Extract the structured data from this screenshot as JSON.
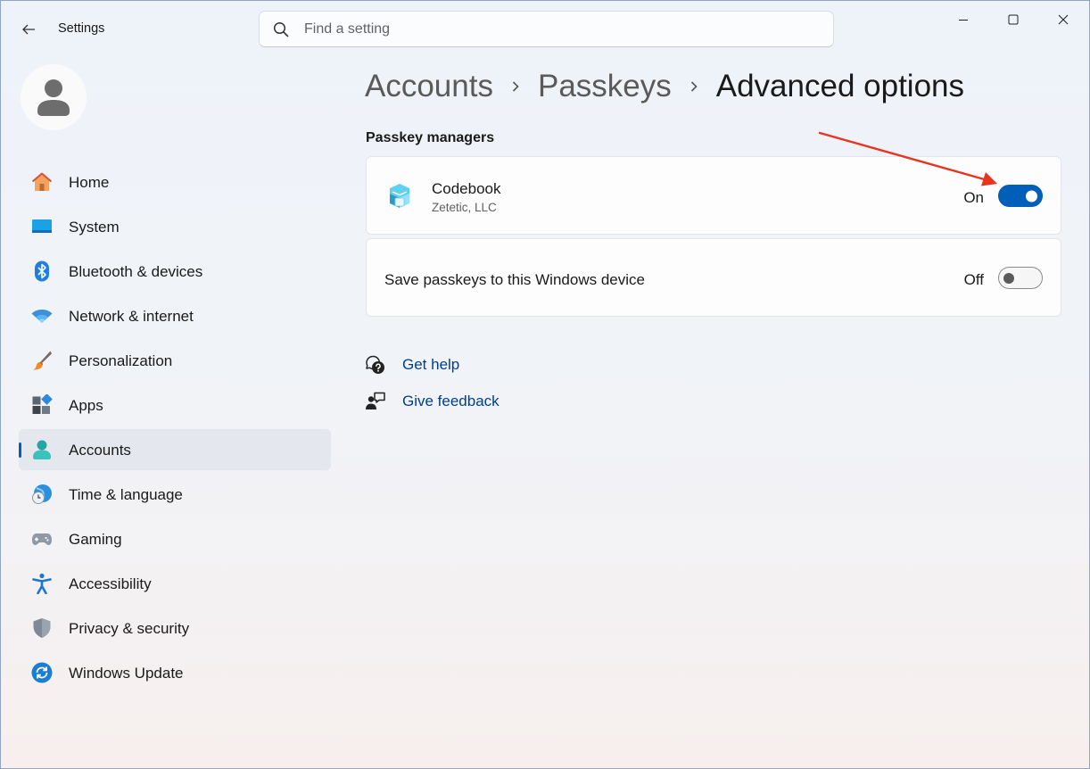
{
  "window": {
    "title": "Settings"
  },
  "search": {
    "placeholder": "Find a setting"
  },
  "sidebar": {
    "items": [
      {
        "label": "Home",
        "icon": "home-icon"
      },
      {
        "label": "System",
        "icon": "system-icon"
      },
      {
        "label": "Bluetooth & devices",
        "icon": "bluetooth-icon"
      },
      {
        "label": "Network & internet",
        "icon": "wifi-icon"
      },
      {
        "label": "Personalization",
        "icon": "brush-icon"
      },
      {
        "label": "Apps",
        "icon": "apps-icon"
      },
      {
        "label": "Accounts",
        "icon": "accounts-icon",
        "selected": true
      },
      {
        "label": "Time & language",
        "icon": "clock-globe-icon"
      },
      {
        "label": "Gaming",
        "icon": "gamepad-icon"
      },
      {
        "label": "Accessibility",
        "icon": "accessibility-icon"
      },
      {
        "label": "Privacy & security",
        "icon": "shield-icon"
      },
      {
        "label": "Windows Update",
        "icon": "update-icon"
      }
    ]
  },
  "breadcrumb": [
    "Accounts",
    "Passkeys",
    "Advanced options"
  ],
  "main": {
    "section_title": "Passkey managers",
    "codebook": {
      "name": "Codebook",
      "publisher": "Zetetic, LLC",
      "toggle_text": "On",
      "enabled": true
    },
    "save_device": {
      "label": "Save passkeys to this Windows device",
      "toggle_text": "Off",
      "enabled": false
    },
    "links": {
      "help": "Get help",
      "feedback": "Give feedback"
    }
  },
  "colors": {
    "accent": "#005fb8",
    "link": "#003e92",
    "annotation_arrow": "#e8341c"
  }
}
